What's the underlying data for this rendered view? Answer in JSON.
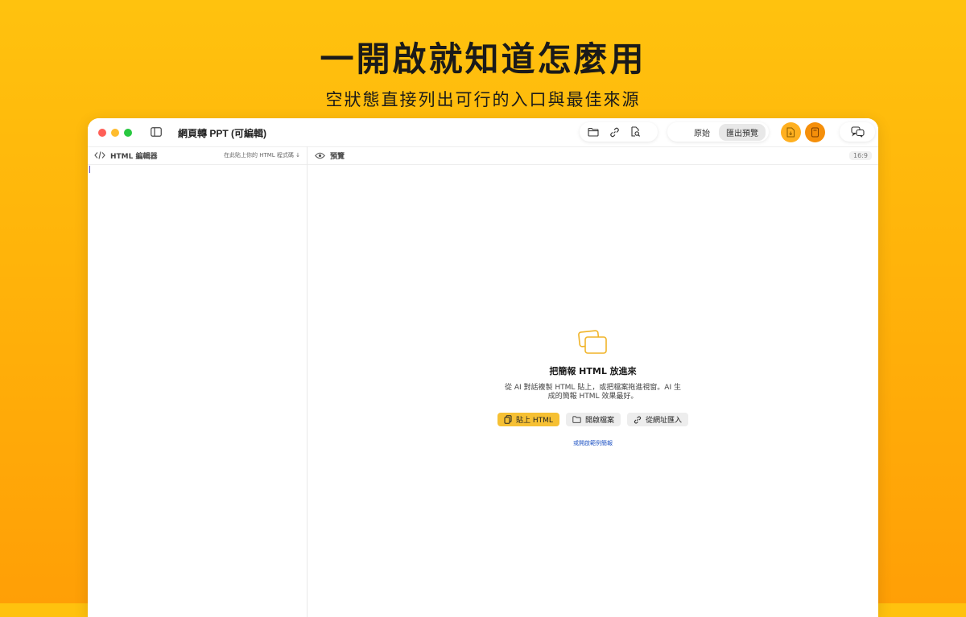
{
  "hero": {
    "title": "一開啟就知道怎麼用",
    "subtitle": "空狀態直接列出可行的入口與最佳來源"
  },
  "window": {
    "title": "網頁轉 PPT (可編輯)",
    "view_modes": [
      "原始",
      "匯出預覽"
    ],
    "active_view_mode": "匯出預覽"
  },
  "editor": {
    "label": "HTML 編輯器",
    "hint": "在此貼上你的 HTML 程式碼 ↓"
  },
  "preview": {
    "label": "預覽",
    "aspect_ratio": "16:9"
  },
  "empty_state": {
    "title": "把簡報 HTML 放進來",
    "description": "從 AI 對話複製 HTML 貼上，或把檔案拖進視窗。AI 生成的簡報 HTML 效果最好。",
    "buttons": {
      "paste": "貼上 HTML",
      "open": "開啟檔案",
      "url": "從網址匯入"
    },
    "sample_link": "或開啟範例簡報"
  },
  "colors": {
    "accent": "#F6C033",
    "export_button": "#FFB020",
    "export_button_active": "#F58F0A",
    "link": "#2457C5"
  }
}
